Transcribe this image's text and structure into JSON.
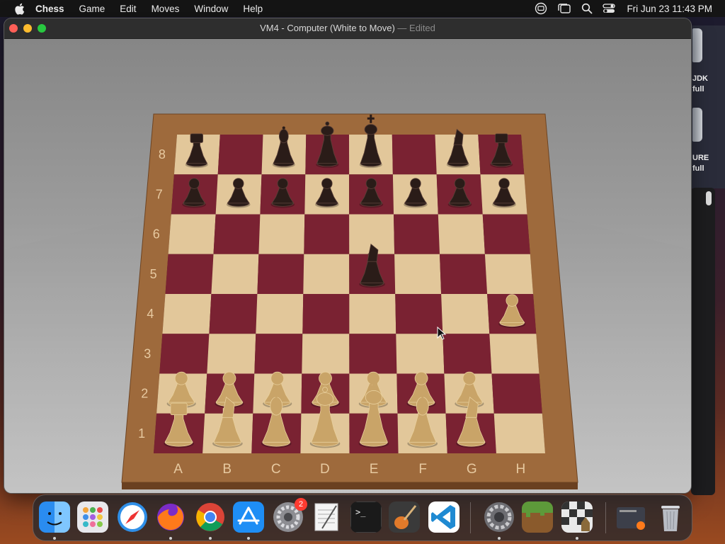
{
  "menubar": {
    "app_name": "Chess",
    "items": [
      "Game",
      "Edit",
      "Moves",
      "Window",
      "Help"
    ],
    "clock": "Fri Jun 23  11:43 PM",
    "status_icons": [
      "screen-share-icon",
      "stage-manager-icon",
      "spotlight-search-icon",
      "control-center-icon"
    ]
  },
  "window": {
    "title": "VM4 - Computer   (White to Move)",
    "title_suffix": "— Edited"
  },
  "board": {
    "files": [
      "A",
      "B",
      "C",
      "D",
      "E",
      "F",
      "G",
      "H"
    ],
    "ranks": [
      "8",
      "7",
      "6",
      "5",
      "4",
      "3",
      "2",
      "1"
    ],
    "light_color": "#e2c79a",
    "dark_color": "#7a2232",
    "frame_color": "#9e6a3c",
    "pieces": [
      {
        "square": "a8",
        "color": "black",
        "type": "rook"
      },
      {
        "square": "c8",
        "color": "black",
        "type": "bishop"
      },
      {
        "square": "d8",
        "color": "black",
        "type": "queen"
      },
      {
        "square": "e8",
        "color": "black",
        "type": "king"
      },
      {
        "square": "g8",
        "color": "black",
        "type": "knight"
      },
      {
        "square": "h8",
        "color": "black",
        "type": "rook"
      },
      {
        "square": "a7",
        "color": "black",
        "type": "pawn"
      },
      {
        "square": "b7",
        "color": "black",
        "type": "pawn"
      },
      {
        "square": "c7",
        "color": "black",
        "type": "pawn"
      },
      {
        "square": "d7",
        "color": "black",
        "type": "pawn"
      },
      {
        "square": "e7",
        "color": "black",
        "type": "pawn"
      },
      {
        "square": "f7",
        "color": "black",
        "type": "pawn"
      },
      {
        "square": "g7",
        "color": "black",
        "type": "pawn"
      },
      {
        "square": "h7",
        "color": "black",
        "type": "pawn"
      },
      {
        "square": "e5",
        "color": "black",
        "type": "knight"
      },
      {
        "square": "h4",
        "color": "white",
        "type": "pawn"
      },
      {
        "square": "a2",
        "color": "white",
        "type": "pawn"
      },
      {
        "square": "b2",
        "color": "white",
        "type": "pawn"
      },
      {
        "square": "c2",
        "color": "white",
        "type": "pawn"
      },
      {
        "square": "d2",
        "color": "white",
        "type": "pawn"
      },
      {
        "square": "e2",
        "color": "white",
        "type": "pawn"
      },
      {
        "square": "f2",
        "color": "white",
        "type": "pawn"
      },
      {
        "square": "g2",
        "color": "white",
        "type": "pawn"
      },
      {
        "square": "a1",
        "color": "white",
        "type": "rook"
      },
      {
        "square": "b1",
        "color": "white",
        "type": "knight"
      },
      {
        "square": "c1",
        "color": "white",
        "type": "bishop"
      },
      {
        "square": "d1",
        "color": "white",
        "type": "queen"
      },
      {
        "square": "e1",
        "color": "white",
        "type": "king"
      },
      {
        "square": "f1",
        "color": "white",
        "type": "bishop"
      },
      {
        "square": "g1",
        "color": "white",
        "type": "knight"
      }
    ]
  },
  "desktop": {
    "labels": [
      [
        "JDK",
        "full"
      ],
      [
        "URE",
        "full"
      ]
    ]
  },
  "dock": {
    "apps": [
      {
        "name": "finder",
        "color": "#2a8cf0",
        "running": true
      },
      {
        "name": "launchpad",
        "color": "#e8e8ec",
        "running": false
      },
      {
        "name": "safari",
        "color": "#2f8fe8",
        "running": false
      },
      {
        "name": "firefox",
        "color": "#ff7a1a",
        "running": true
      },
      {
        "name": "chrome",
        "color": "#ffffff",
        "running": true
      },
      {
        "name": "app-store",
        "color": "#1e8ef5",
        "running": true
      },
      {
        "name": "system-settings",
        "color": "#8d8d92",
        "running": false,
        "badge": "2"
      },
      {
        "name": "textedit",
        "color": "#f4f4f4",
        "running": false
      },
      {
        "name": "terminal",
        "color": "#1a1a1a",
        "running": false
      },
      {
        "name": "garageband",
        "color": "#3a3a3a",
        "running": false
      },
      {
        "name": "vscode",
        "color": "#ffffff",
        "running": false
      },
      {
        "name": "system-preferences",
        "color": "#6d6d72",
        "running": true
      },
      {
        "name": "minecraft",
        "color": "#5d9a3a",
        "running": false
      },
      {
        "name": "chess",
        "color": "#e9e9e9",
        "running": true
      },
      {
        "name": "downloads-stack",
        "color": "#3c3f4a",
        "running": false
      },
      {
        "name": "trash",
        "color": "#b8bcc4",
        "running": false
      }
    ]
  }
}
